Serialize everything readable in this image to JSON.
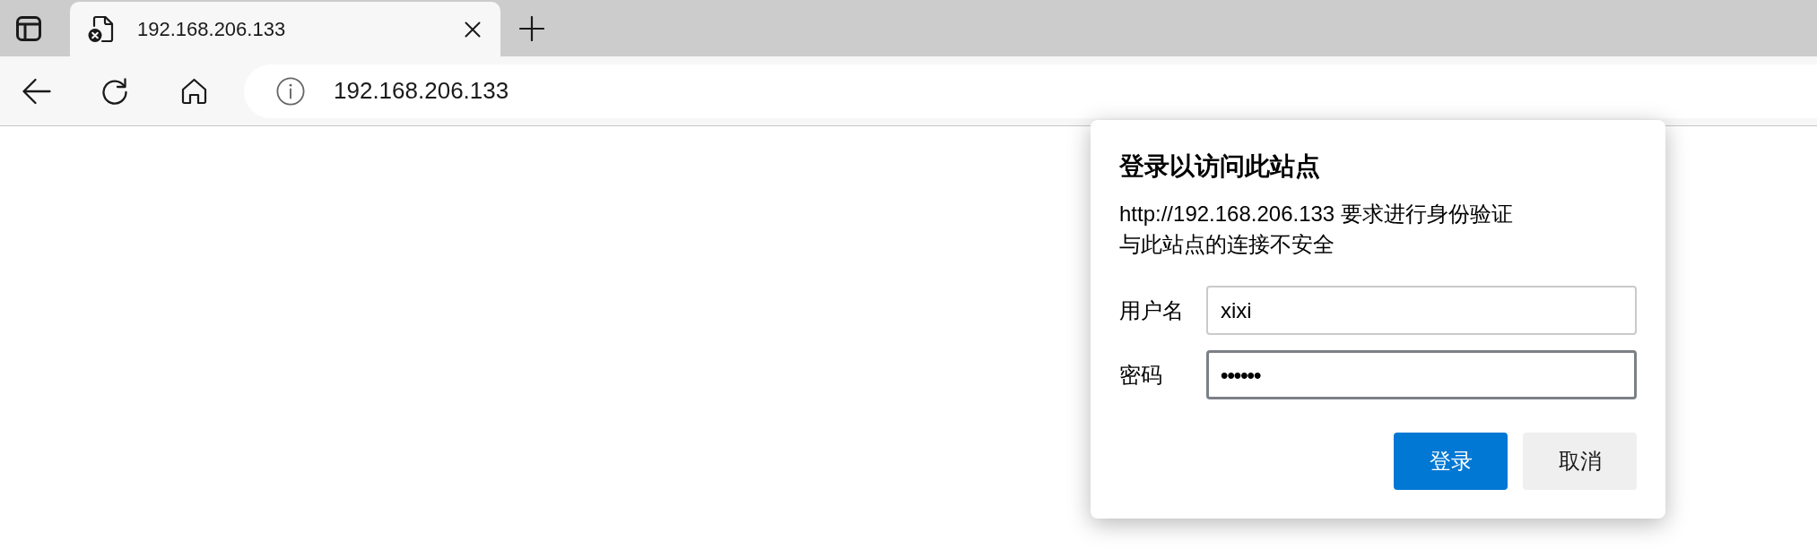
{
  "browser": {
    "tabs": [
      {
        "title": "192.168.206.133",
        "selected": true
      }
    ],
    "address_bar": {
      "url": "192.168.206.133"
    }
  },
  "dialog": {
    "title": "登录以访问此站点",
    "message_lines": [
      "http://192.168.206.133 要求进行身份验证",
      "与此站点的连接不安全"
    ],
    "fields": [
      {
        "label": "用户名",
        "value": "xixi",
        "kind": "username",
        "focused": false
      },
      {
        "label": "密码",
        "value": "••••••",
        "kind": "password",
        "focused": true
      }
    ],
    "buttons": [
      {
        "label": "登录",
        "kind": "submit"
      },
      {
        "label": "取消",
        "kind": "cancel"
      }
    ]
  }
}
